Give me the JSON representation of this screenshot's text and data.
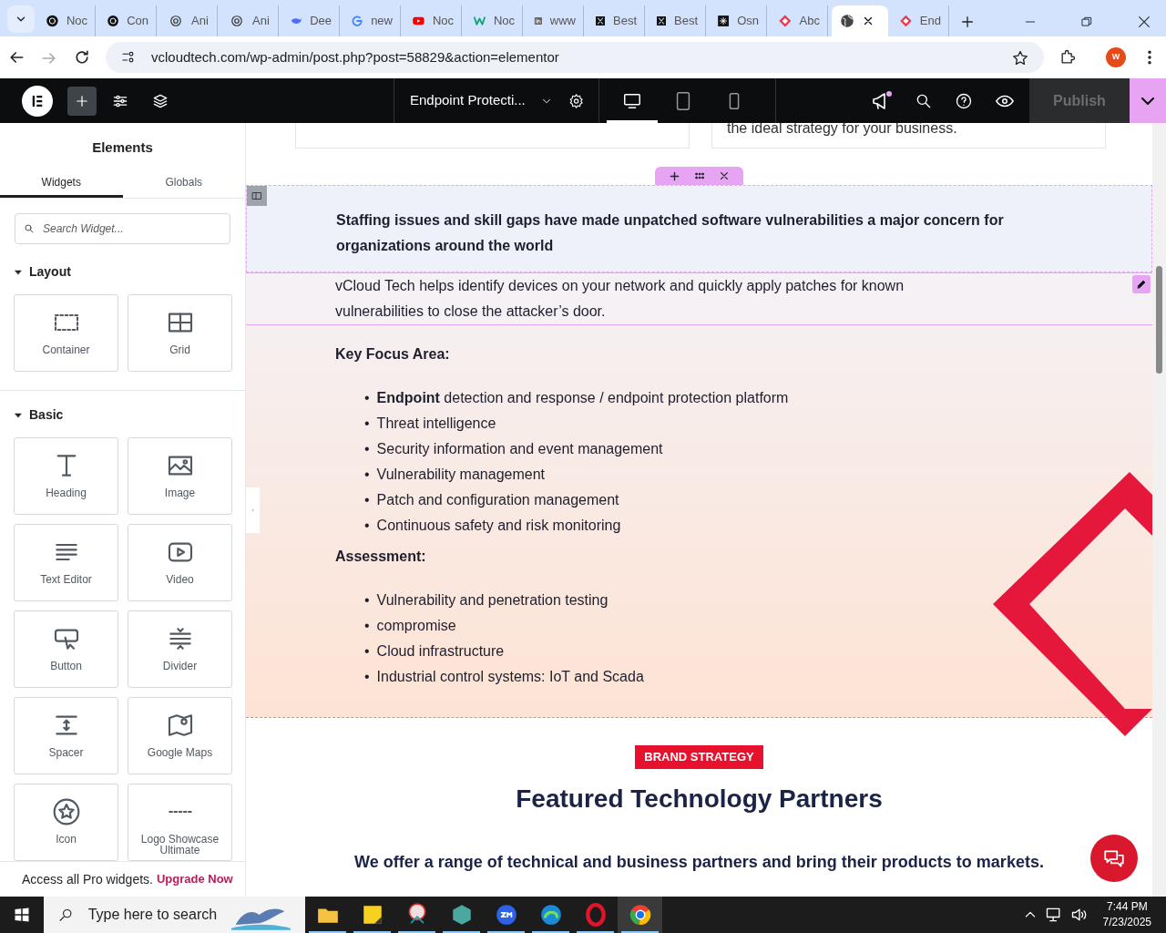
{
  "browser": {
    "tabs": [
      {
        "label": "Noc",
        "kind": "knot-dark",
        "selected": false
      },
      {
        "label": "Con",
        "kind": "knot-dark",
        "selected": false
      },
      {
        "label": "Ani",
        "kind": "knot",
        "selected": false
      },
      {
        "label": "Ani",
        "kind": "knot",
        "selected": false
      },
      {
        "label": "Dee",
        "kind": "whale",
        "selected": false
      },
      {
        "label": "new",
        "kind": "g",
        "selected": false
      },
      {
        "label": "Noc",
        "kind": "play",
        "selected": false
      },
      {
        "label": "Noc",
        "kind": "w",
        "selected": false
      },
      {
        "label": "www",
        "kind": "in",
        "selected": false
      },
      {
        "label": "Best",
        "kind": "x",
        "selected": false
      },
      {
        "label": "Best",
        "kind": "x",
        "selected": false
      },
      {
        "label": "Osn",
        "kind": "star",
        "selected": false
      },
      {
        "label": "Abc",
        "kind": "diamond",
        "selected": false
      },
      {
        "kind": "globe",
        "selected": true
      },
      {
        "label": "End",
        "kind": "diamond",
        "selected": false
      }
    ],
    "url": "vcloudtech.com/wp-admin/post.php?post=58829&action=elementor",
    "profile_initial": "W"
  },
  "editor_toolbar": {
    "document_title": "Endpoint Protecti...",
    "devices": [
      {
        "kind": "desktop",
        "selected": true
      },
      {
        "kind": "tablet",
        "selected": false
      },
      {
        "kind": "mobile",
        "selected": false
      }
    ],
    "publish": {
      "label": "Publish",
      "disabled": true
    }
  },
  "panel": {
    "title": "Elements",
    "tabs": [
      {
        "label": "Widgets",
        "selected": true
      },
      {
        "label": "Globals",
        "selected": false
      }
    ],
    "search": {
      "placeholder": "Search Widget..."
    },
    "sections": [
      {
        "title": "Layout",
        "expanded": true,
        "widgets": [
          {
            "label": "Container",
            "kind": "container"
          },
          {
            "label": "Grid",
            "kind": "grid"
          }
        ]
      },
      {
        "title": "Basic",
        "expanded": true,
        "widgets": [
          {
            "label": "Heading",
            "kind": "heading"
          },
          {
            "label": "Image",
            "kind": "image"
          },
          {
            "label": "Text Editor",
            "kind": "text"
          },
          {
            "label": "Video",
            "kind": "video"
          },
          {
            "label": "Button",
            "kind": "button"
          },
          {
            "label": "Divider",
            "kind": "divider"
          },
          {
            "label": "Spacer",
            "kind": "spacer"
          },
          {
            "label": "Google Maps",
            "kind": "map"
          },
          {
            "label": "Icon",
            "kind": "star"
          },
          {
            "label": "Logo Showcase Ultimate",
            "kind": "logos"
          }
        ]
      }
    ],
    "promo": {
      "text": "Access all Pro widgets.",
      "link": "Upgrade Now"
    }
  },
  "canvas": {
    "top_card_text": "the ideal strategy for your business.",
    "intro_heading": "Staffing issues and skill gaps have made unpatched software vulnerabilities a major concern for organizations around the world",
    "intro_paragraph": "vCloud Tech helps identify devices on your network and quickly apply patches for known vulnerabilities to close the attacker’s door.",
    "lists": [
      {
        "heading": "Key Focus Area:",
        "marker": "•",
        "items": [
          "**Endpoint** detection and response / endpoint protection platform",
          "Threat intelligence",
          "Security information and event management",
          "Vulnerability management",
          "Patch and configuration management",
          "Continuous safety and risk monitoring"
        ]
      },
      {
        "heading": "Assessment:",
        "marker": "•",
        "items": [
          "Vulnerability and penetration testing",
          "compromise",
          "Cloud infrastructure",
          "Industrial control systems: IoT and Scada"
        ]
      }
    ],
    "badge": "BRAND STRATEGY",
    "title": "Featured Technology Partners",
    "subtitle": "We offer a range of technical and business partners and bring their products to markets."
  },
  "taskbar": {
    "search_placeholder": "Type here to search",
    "apps": [
      {
        "kind": "folder",
        "selected": false
      },
      {
        "kind": "note",
        "selected": false
      },
      {
        "kind": "snip",
        "selected": false
      },
      {
        "kind": "hex",
        "selected": false
      },
      {
        "kind": "zm",
        "selected": false
      },
      {
        "kind": "edge",
        "selected": false
      },
      {
        "kind": "opera",
        "selected": false
      },
      {
        "kind": "chrome",
        "selected": true
      }
    ],
    "time": "7:44 PM",
    "date": "7/23/2025"
  }
}
